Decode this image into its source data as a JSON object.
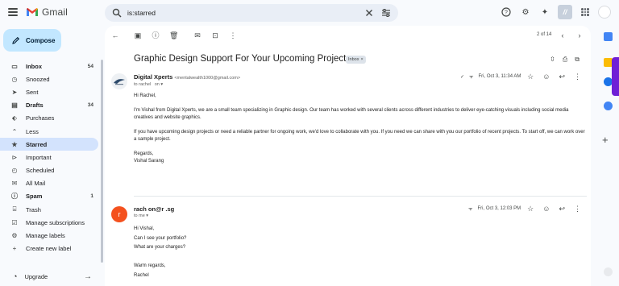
{
  "app": {
    "name": "Gmail"
  },
  "search": {
    "value": "is:starred"
  },
  "compose": {
    "label": "Compose"
  },
  "sidebar": {
    "items": [
      {
        "label": "Inbox",
        "icon": "inbox-icon",
        "glyph": "▭",
        "count": "54",
        "bold": true
      },
      {
        "label": "Snoozed",
        "icon": "clock-icon",
        "glyph": "◷",
        "count": ""
      },
      {
        "label": "Sent",
        "icon": "send-icon",
        "glyph": "➤",
        "count": ""
      },
      {
        "label": "Drafts",
        "icon": "draft-icon",
        "glyph": "▤",
        "count": "34",
        "bold": true
      },
      {
        "label": "Purchases",
        "icon": "tag-icon",
        "glyph": "⬖",
        "count": ""
      },
      {
        "label": "Less",
        "icon": "chevron-up-icon",
        "glyph": "⌃",
        "count": ""
      },
      {
        "label": "Starred",
        "icon": "star-icon",
        "glyph": "★",
        "count": "",
        "active": true
      },
      {
        "label": "Important",
        "icon": "important-icon",
        "glyph": "⊳",
        "count": ""
      },
      {
        "label": "Scheduled",
        "icon": "scheduled-icon",
        "glyph": "◴",
        "count": ""
      },
      {
        "label": "All Mail",
        "icon": "all-mail-icon",
        "glyph": "✉",
        "count": ""
      },
      {
        "label": "Spam",
        "icon": "spam-icon",
        "glyph": "ⓘ",
        "count": "1",
        "bold": true
      },
      {
        "label": "Trash",
        "icon": "trash-icon",
        "glyph": "⌸",
        "count": ""
      },
      {
        "label": "Manage subscriptions",
        "icon": "subscriptions-icon",
        "glyph": "☑",
        "count": ""
      },
      {
        "label": "Manage labels",
        "icon": "gear-icon",
        "glyph": "⚙",
        "count": ""
      },
      {
        "label": "Create new label",
        "icon": "plus-icon",
        "glyph": "+",
        "count": ""
      }
    ],
    "upgrade_label": "Upgrade"
  },
  "toolbar": {
    "pager": "2 of 14"
  },
  "thread": {
    "subject": "Graphic Design Support For Your Upcoming Project",
    "label": "Inbox"
  },
  "messages": [
    {
      "sender": "Digital Xperts",
      "email": "<mentalwealth1000@gmail.com>",
      "to": "to rachel",
      "to_suffix": "on",
      "date": "Fri, Oct 3, 11:34 AM",
      "body": [
        "Hi Rachel,",
        "I'm Vishal from Digital Xperts, we are a small team specializing in Graphic design. Our team has worked with several clients across different industries to deliver eye-catching visuals including social media creatives and website graphics.",
        "If you have upcoming design projects or need a reliable partner for ongoing work, we'd love to collaborate with you. If you need we can share with you our portfolio of recent projects. To start off, we can work over a sample project.",
        "Regards,\nVishal Sarang"
      ]
    },
    {
      "avatar_letter": "r",
      "sender": "rach      on@r      .sg",
      "to": "to me",
      "date": "Fri, Oct 3, 12:03 PM",
      "body": [
        "Hi Vishal,",
        "Can I see your portfolio?",
        "What are your charges?",
        "",
        "Warm regards,",
        "Rachel"
      ]
    }
  ],
  "colors": {
    "accent": "#c2e7ff",
    "active_nav": "#d3e3fd",
    "avatar_r": "#f4511e",
    "brand_purple": "#6f1fd6"
  }
}
